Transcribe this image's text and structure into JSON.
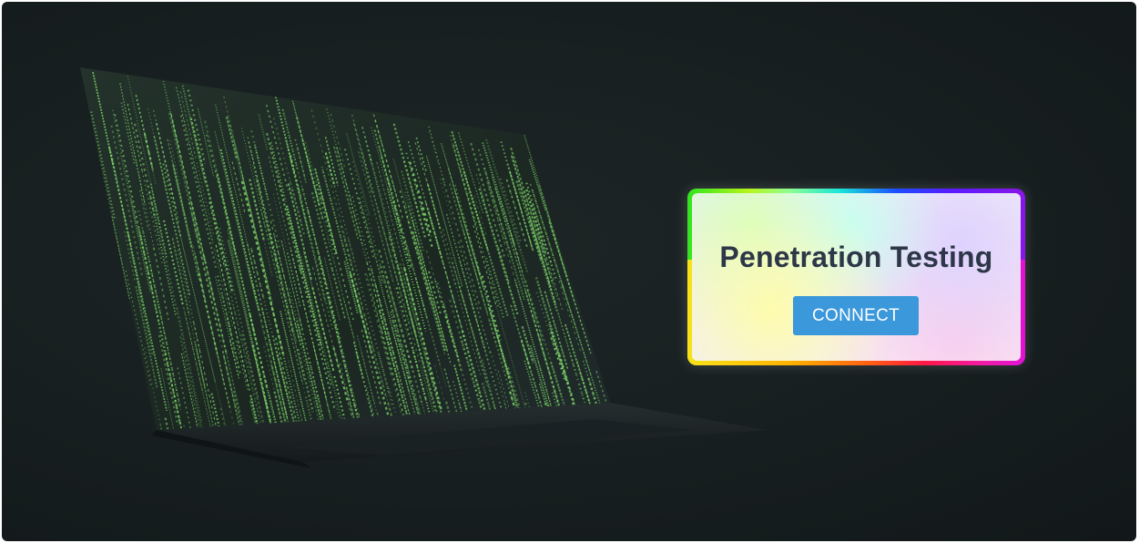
{
  "hero": {
    "image": "laptop-matrix-code-photo"
  },
  "card": {
    "title": "Penetration Testing",
    "button_label": "CONNECT"
  },
  "colors": {
    "background": "#182021",
    "title": "#2d3748",
    "button": "#3a98db",
    "button_text": "#ffffff",
    "matrix_green": "#7fd86a"
  }
}
